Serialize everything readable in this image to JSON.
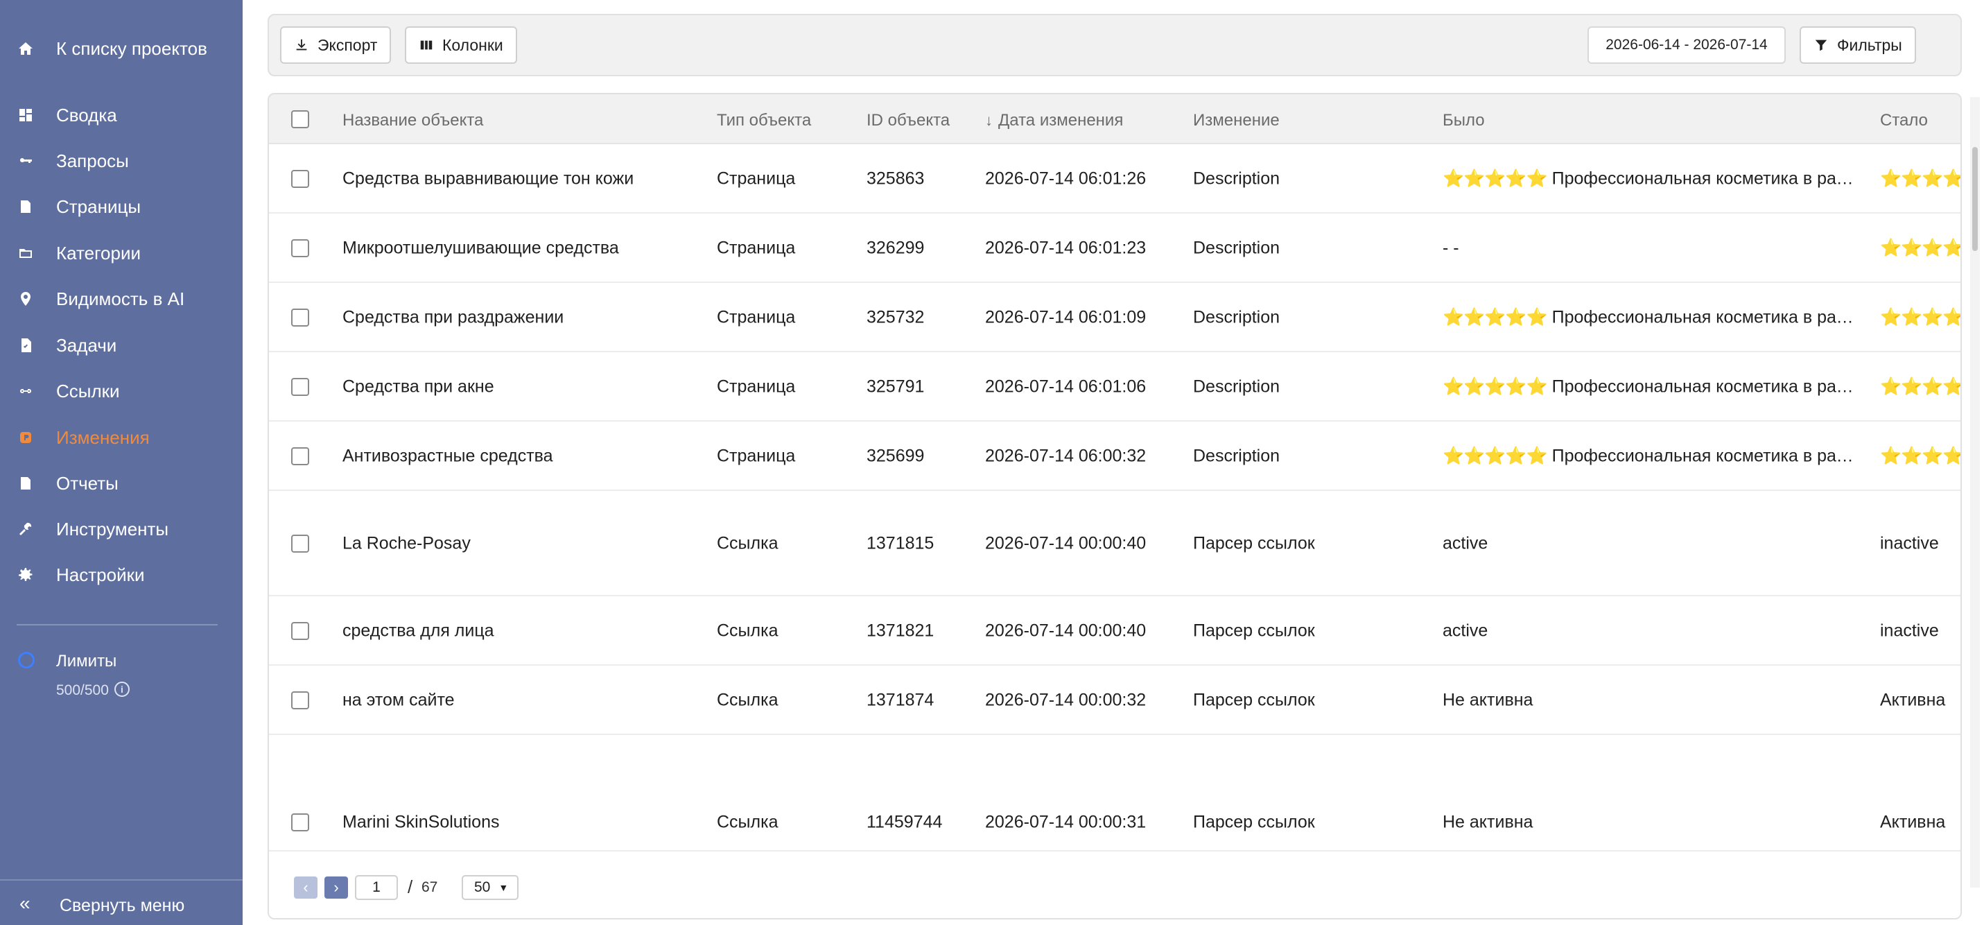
{
  "sidebar": {
    "back": {
      "label": "К списку проектов",
      "icon": "home-icon"
    },
    "items": [
      {
        "label": "Сводка",
        "icon": "dashboard-icon"
      },
      {
        "label": "Запросы",
        "icon": "key-icon"
      },
      {
        "label": "Страницы",
        "icon": "page-icon"
      },
      {
        "label": "Категории",
        "icon": "folder-icon"
      },
      {
        "label": "Видимость в AI",
        "icon": "pin-icon"
      },
      {
        "label": "Задачи",
        "icon": "task-icon"
      },
      {
        "label": "Ссылки",
        "icon": "link-icon"
      },
      {
        "label": "Изменения",
        "icon": "changes-icon",
        "active": true
      },
      {
        "label": "Отчеты",
        "icon": "report-icon"
      },
      {
        "label": "Инструменты",
        "icon": "tools-icon"
      },
      {
        "label": "Настройки",
        "icon": "gear-icon"
      }
    ],
    "limits": {
      "title": "Лимиты",
      "value": "500/500"
    },
    "collapse": "Свернуть меню",
    "active_color": "#f28a3c",
    "bg_color": "#5e6e9e"
  },
  "toolbar": {
    "export_label": "Экспорт",
    "columns_label": "Колонки",
    "date_range": "2026-06-14 - 2026-07-14",
    "filters_label": "Фильтры"
  },
  "table": {
    "columns": [
      "Название объекта",
      "Тип объекта",
      "ID объекта",
      "Дата изменения",
      "Изменение",
      "Было",
      "Стало"
    ],
    "sort_arrow": "↓",
    "rows": [
      {
        "name": "Средства выравнивающие тон кожи",
        "type": "Страница",
        "id": "325863",
        "date": "2026-07-14 06:01:26",
        "change": "Description",
        "was_stars": "⭐⭐⭐⭐⭐",
        "was": "Профессиональная косметика в разде...",
        "now_stars": "⭐⭐⭐⭐⭐",
        "now": ""
      },
      {
        "name": "Микроотшелушивающие средства",
        "type": "Страница",
        "id": "326299",
        "date": "2026-07-14 06:01:23",
        "change": "Description",
        "was_stars": "",
        "was": "- -",
        "now_stars": "⭐⭐⭐⭐⭐",
        "now": ""
      },
      {
        "name": "Средства при раздражении",
        "type": "Страница",
        "id": "325732",
        "date": "2026-07-14 06:01:09",
        "change": "Description",
        "was_stars": "⭐⭐⭐⭐⭐",
        "was": "Профессиональная косметика в разде...",
        "now_stars": "⭐⭐⭐⭐⭐",
        "now": ""
      },
      {
        "name": "Средства при акне",
        "type": "Страница",
        "id": "325791",
        "date": "2026-07-14 06:01:06",
        "change": "Description",
        "was_stars": "⭐⭐⭐⭐⭐",
        "was": "Профессиональная косметика в разде...",
        "now_stars": "⭐⭐⭐⭐⭐",
        "now": ""
      },
      {
        "name": "Антивозрастные средства",
        "type": "Страница",
        "id": "325699",
        "date": "2026-07-14 06:00:32",
        "change": "Description",
        "was_stars": "⭐⭐⭐⭐⭐",
        "was": "Профессиональная косметика в разде...",
        "now_stars": "⭐⭐⭐⭐⭐",
        "now": ""
      },
      {
        "name": "La Roche-Posay",
        "type": "Ссылка",
        "id": "1371815",
        "date": "2026-07-14 00:00:40",
        "change": "Парсер ссылок",
        "was_stars": "",
        "was": "active",
        "now_stars": "",
        "now": "inactive"
      },
      {
        "name": "средства для лица",
        "type": "Ссылка",
        "id": "1371821",
        "date": "2026-07-14 00:00:40",
        "change": "Парсер ссылок",
        "was_stars": "",
        "was": "active",
        "now_stars": "",
        "now": "inactive"
      },
      {
        "name": "на этом сайте",
        "type": "Ссылка",
        "id": "1371874",
        "date": "2026-07-14 00:00:32",
        "change": "Парсер ссылок",
        "was_stars": "",
        "was": "Не активна",
        "now_stars": "",
        "now": "Активна"
      },
      {
        "name": "Marini SkinSolutions",
        "type": "Ссылка",
        "id": "11459744",
        "date": "2026-07-14 00:00:31",
        "change": "Парсер ссылок",
        "was_stars": "",
        "was": "Не активна",
        "now_stars": "",
        "now": "Активна"
      }
    ]
  },
  "pager": {
    "prev": "‹",
    "next": "›",
    "page": "1",
    "separator": "/",
    "total": "67",
    "page_size": "50"
  }
}
